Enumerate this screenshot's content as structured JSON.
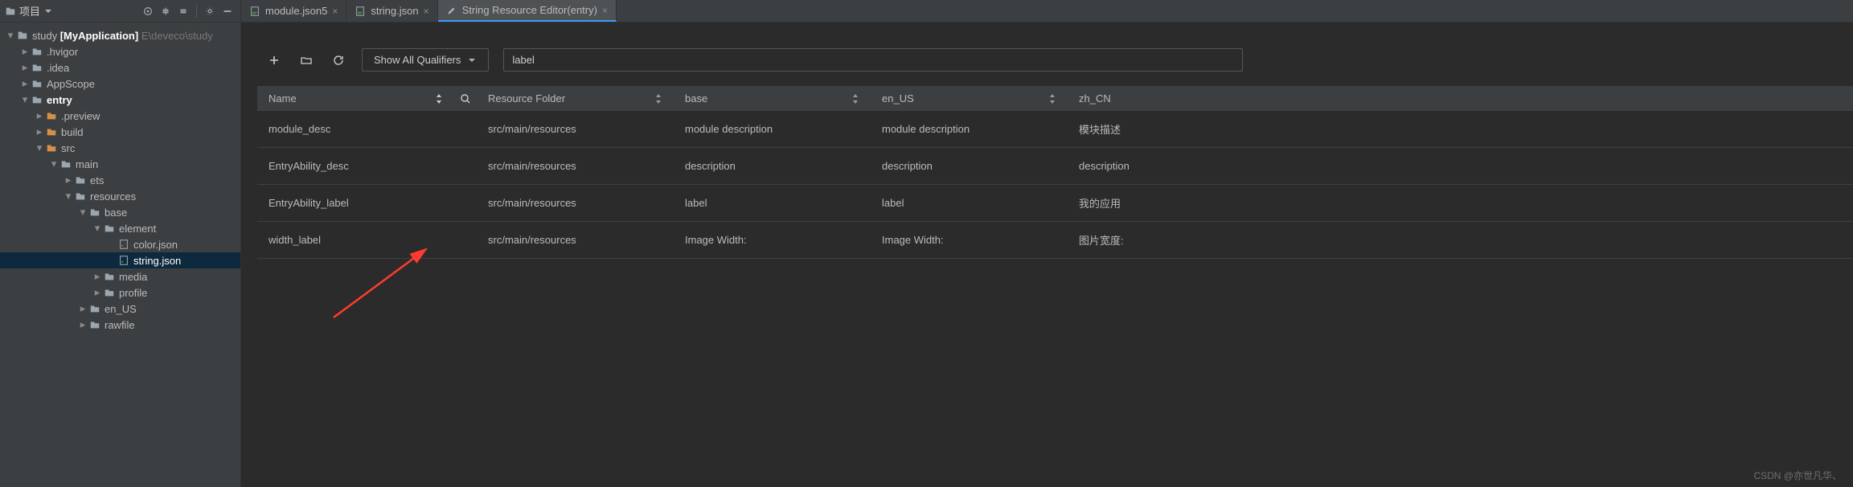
{
  "sidebar": {
    "project_label": "项目",
    "tree": {
      "root_name": "study",
      "root_bold": "[MyApplication]",
      "root_path": "E\\deveco\\study",
      "items": [
        {
          "label": ".hvigor",
          "indent": 1,
          "chev": "right",
          "color": "gray"
        },
        {
          "label": ".idea",
          "indent": 1,
          "chev": "right",
          "color": "gray"
        },
        {
          "label": "AppScope",
          "indent": 1,
          "chev": "right",
          "color": "gray"
        },
        {
          "label": "entry",
          "indent": 1,
          "chev": "down",
          "color": "gray",
          "bold": true
        },
        {
          "label": ".preview",
          "indent": 2,
          "chev": "right",
          "color": "orange"
        },
        {
          "label": "build",
          "indent": 2,
          "chev": "right",
          "color": "orange"
        },
        {
          "label": "src",
          "indent": 2,
          "chev": "down",
          "color": "orange"
        },
        {
          "label": "main",
          "indent": 3,
          "chev": "down",
          "color": "gray"
        },
        {
          "label": "ets",
          "indent": 4,
          "chev": "right",
          "color": "gray"
        },
        {
          "label": "resources",
          "indent": 4,
          "chev": "down",
          "color": "gray"
        },
        {
          "label": "base",
          "indent": 5,
          "chev": "down",
          "color": "gray"
        },
        {
          "label": "element",
          "indent": 6,
          "chev": "down",
          "color": "gray"
        },
        {
          "label": "color.json",
          "indent": 7,
          "chev": "",
          "color": "file"
        },
        {
          "label": "string.json",
          "indent": 7,
          "chev": "",
          "color": "file",
          "selected": true
        },
        {
          "label": "media",
          "indent": 6,
          "chev": "right",
          "color": "gray"
        },
        {
          "label": "profile",
          "indent": 6,
          "chev": "right",
          "color": "gray"
        },
        {
          "label": "en_US",
          "indent": 5,
          "chev": "right",
          "color": "gray"
        },
        {
          "label": "rawfile",
          "indent": 5,
          "chev": "right",
          "color": "gray"
        }
      ]
    }
  },
  "tabs": [
    {
      "label": "module.json5",
      "active": false,
      "icon": "json"
    },
    {
      "label": "string.json",
      "active": false,
      "icon": "json"
    },
    {
      "label": "String Resource Editor(entry)",
      "active": true,
      "icon": "edit"
    }
  ],
  "editor_tools": {
    "qualifier_label": "Show All Qualifiers",
    "search_value": "label"
  },
  "table": {
    "columns": [
      "Name",
      "Resource Folder",
      "base",
      "en_US",
      "zh_CN"
    ],
    "rows": [
      {
        "name": "module_desc",
        "folder": "src/main/resources",
        "base": "module description",
        "en": "module description",
        "zh": "模块描述"
      },
      {
        "name": "EntryAbility_desc",
        "folder": "src/main/resources",
        "base": "description",
        "en": "description",
        "zh": "description"
      },
      {
        "name": "EntryAbility_label",
        "folder": "src/main/resources",
        "base": "label",
        "en": "label",
        "zh": "我的应用"
      },
      {
        "name": "width_label",
        "folder": "src/main/resources",
        "base": "Image Width:",
        "en": "Image Width:",
        "zh": "图片宽度:"
      }
    ]
  },
  "watermark": "CSDN @亦世凡华、"
}
